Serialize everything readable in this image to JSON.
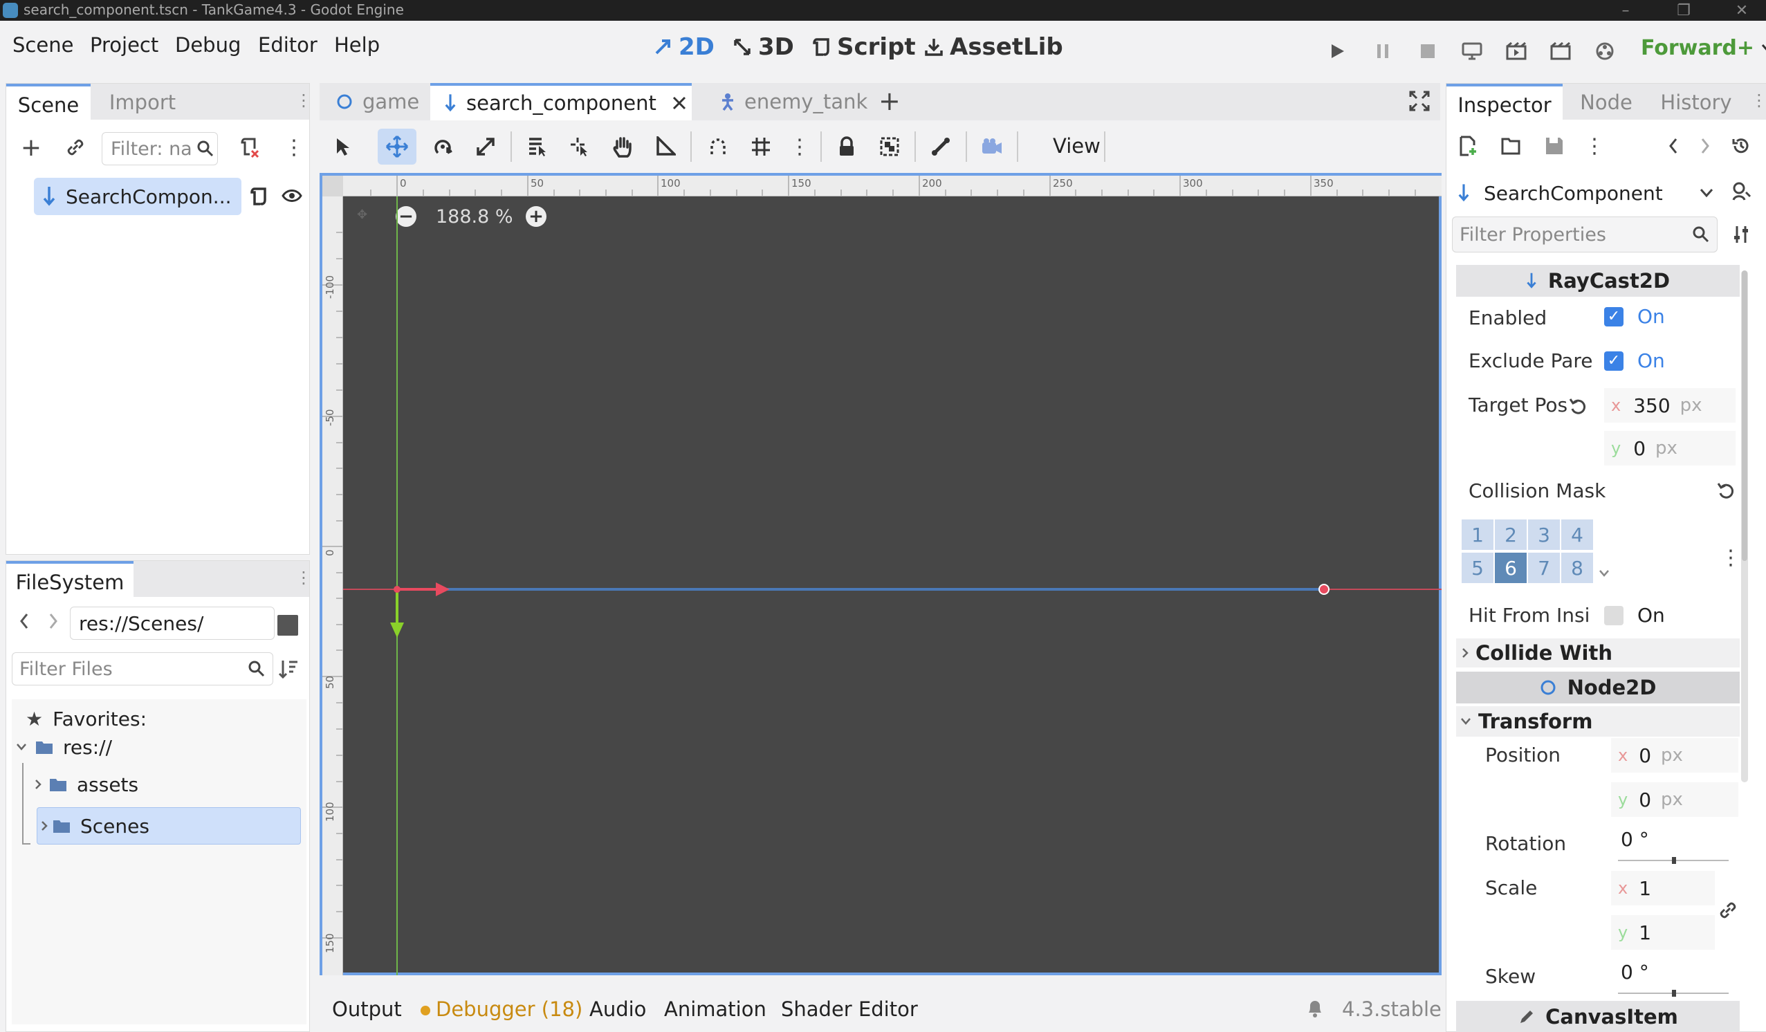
{
  "window": {
    "title": "search_component.tscn - TankGame4.3 - Godot Engine"
  },
  "menu": {
    "items": [
      "Scene",
      "Project",
      "Debug",
      "Editor",
      "Help"
    ]
  },
  "main_tools": {
    "t2d": "2D",
    "t3d": "3D",
    "script": "Script",
    "assetlib": "AssetLib"
  },
  "renderer": "Forward+",
  "scene_dock": {
    "tabs": [
      "Scene",
      "Import"
    ],
    "filter_placeholder": "Filter: na",
    "root_node": "SearchCompon..."
  },
  "filesystem": {
    "tab": "FileSystem",
    "path": "res://Scenes/",
    "filter_placeholder": "Filter Files",
    "tree": {
      "favorites": "Favorites:",
      "root": "res://",
      "assets": "assets",
      "scenes": "Scenes"
    }
  },
  "editor_tabs": [
    "game",
    "search_component",
    "enemy_tank"
  ],
  "viewport": {
    "view_menu": "View",
    "zoom": "188.8 %",
    "ruler_h": [
      "0",
      "50",
      "100",
      "150",
      "200",
      "250",
      "300",
      "350"
    ],
    "ruler_v": [
      "-100",
      "-50",
      "0",
      "50",
      "100",
      "150"
    ]
  },
  "bottom_panel": {
    "tabs": [
      "Output",
      "Debugger (18)",
      "Audio",
      "Animation",
      "Shader Editor"
    ],
    "version": "4.3.stable"
  },
  "inspector": {
    "tabs": [
      "Inspector",
      "Node",
      "History"
    ],
    "object": "SearchComponent",
    "filter_placeholder": "Filter Properties",
    "raycast_header": "RayCast2D",
    "enabled_label": "Enabled",
    "enabled_value": "On",
    "exclude_label": "Exclude Pare",
    "exclude_value": "On",
    "target_label": "Target Pos",
    "target_x": "350",
    "target_y": "0",
    "unit_px": "px",
    "axis_x": "x",
    "axis_y": "y",
    "collision_label": "Collision Mask",
    "bits": [
      "1",
      "2",
      "3",
      "4",
      "5",
      "6",
      "7",
      "8"
    ],
    "hit_label": "Hit From Insi",
    "hit_value": "On",
    "collide_with": "Collide With",
    "node2d_header": "Node2D",
    "transform": "Transform",
    "position_label": "Position",
    "position_x": "0",
    "position_y": "0",
    "rotation_label": "Rotation",
    "rotation_value": "0 °",
    "scale_label": "Scale",
    "scale_x": "1",
    "scale_y": "1",
    "skew_label": "Skew",
    "skew_value": "0 °",
    "canvasitem_header": "CanvasItem"
  }
}
